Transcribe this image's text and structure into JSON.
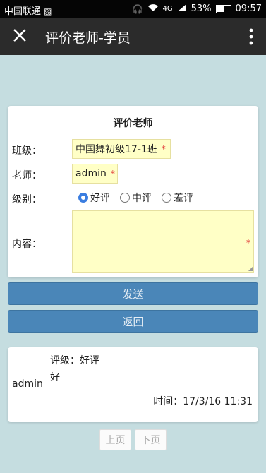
{
  "statusbar": {
    "carrier": "中国联通",
    "network": "4G",
    "battery": "53%",
    "time": "09:57",
    "icons": [
      "image-icon",
      "headphones-icon",
      "wifi-icon",
      "signal-icon",
      "battery-icon"
    ]
  },
  "appbar": {
    "title": "评价老师-学员",
    "icons": [
      "close-icon",
      "more-vert-icon"
    ]
  },
  "form": {
    "title": "评价老师",
    "class_label": "班级：",
    "class_value": "中国舞初级17-1班",
    "teacher_label": "老师：",
    "teacher_value": "admin",
    "level_label": "级别：",
    "level_options": [
      "好评",
      "中评",
      "差评"
    ],
    "level_selected": "好评",
    "content_label": "内容：",
    "content_value": "",
    "required_mark": "*"
  },
  "buttons": {
    "send": "发送",
    "back": "返回"
  },
  "review": {
    "author": "admin",
    "level": "评级：好评",
    "content": "好",
    "time": "时间：17/3/16 11:31"
  },
  "pager": {
    "prev": "上页",
    "next": "下页"
  },
  "colors": {
    "background": "#c5dde0",
    "appbar": "#2b2b2b",
    "button": "#4a86b8",
    "field": "#ffffc6",
    "radio_checked": "#3a7de0"
  }
}
